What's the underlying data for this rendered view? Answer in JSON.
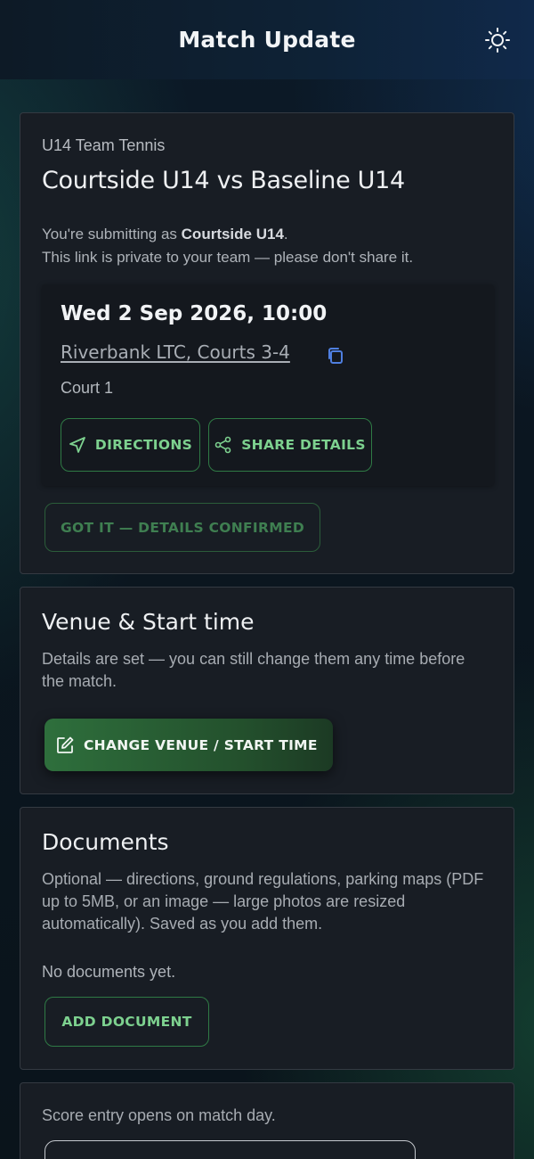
{
  "header": {
    "title": "Match Update",
    "theme_icon": "sun-icon"
  },
  "match": {
    "competition": "U14 Team Tennis",
    "title": "Courtside U14 vs Baseline U14",
    "notice_prefix": "You're submitting as ",
    "team": "Courtside U14",
    "notice_suffix": ".",
    "notice_line2": "This link is private to your team — please don't share it."
  },
  "details": {
    "datetime": "Wed 2 Sep 2026, 10:00",
    "venue": "Riverbank LTC, Courts 3-4",
    "court": "Court 1",
    "directions_label": "DIRECTIONS",
    "share_label": "SHARE DETAILS",
    "confirm_label": "GOT IT — DETAILS CONFIRMED"
  },
  "venue_section": {
    "title": "Venue & Start time",
    "description": "Details are set — you can still change them any time before the match.",
    "change_label": "CHANGE VENUE / START TIME"
  },
  "documents": {
    "title": "Documents",
    "description": "Optional — directions, ground regulations, parking maps (PDF up to 5MB, or an image — large photos are resized automatically). Saved as you add them.",
    "empty_text": "No documents yet.",
    "add_label": "ADD DOCUMENT"
  },
  "score": {
    "text": "Score entry opens on match day."
  },
  "colors": {
    "accent_green": "#7dd18f",
    "primary_button": "#2e6f3c",
    "card_bg": "#181d24"
  }
}
